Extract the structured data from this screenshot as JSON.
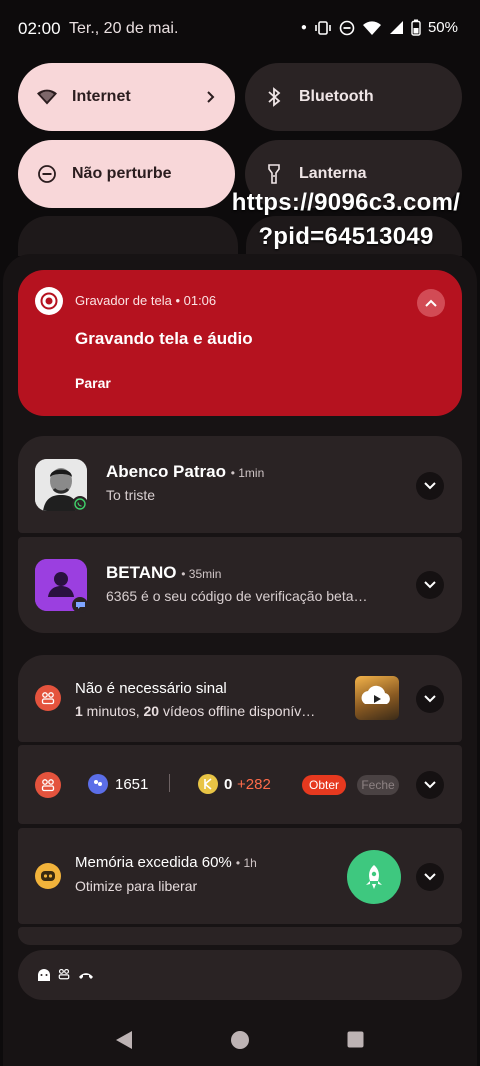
{
  "status_bar": {
    "time": "02:00",
    "date": "Ter., 20 de mai.",
    "battery": "50%"
  },
  "quick_tiles": [
    {
      "label": "Internet",
      "icon": "wifi-icon",
      "active": true
    },
    {
      "label": "Bluetooth",
      "icon": "bluetooth-icon",
      "active": false
    },
    {
      "label": "Não perturbe",
      "icon": "dnd-icon",
      "active": true
    },
    {
      "label": "Lanterna",
      "icon": "flashlight-icon",
      "active": false
    }
  ],
  "overlay_text": {
    "line1": "https://9096c3.com/",
    "line2": "?pid=64513049"
  },
  "recorder": {
    "app": "Gravador de tela • 01:06",
    "title": "Gravando tela e áudio",
    "action": "Parar",
    "accent": "#b5121f"
  },
  "notifications": {
    "whatsapp": {
      "title": "Abenco Patrao",
      "time": "• 1min",
      "body": "To triste"
    },
    "betano": {
      "title": "BETANO",
      "time": "• 35min",
      "body": "6365 é o seu código de verificação beta…"
    },
    "offline": {
      "title": "Não é necessário sinal",
      "body_num1": "1",
      "body_mid": " minutos, ",
      "body_num2": "20",
      "body_rest": " vídeos offline disponív…"
    },
    "coins": {
      "gems": "1651",
      "coins": "0",
      "bonus": "+282",
      "obter": "Obter",
      "feche": "Feche"
    },
    "memory": {
      "title": "Memória excedida 60%",
      "time": "• 1h",
      "body": "Otimize para liberar"
    }
  },
  "colors": {
    "tile_on": "#f8d7d9",
    "tile_off": "#2a2324",
    "card": "#2a2324",
    "rocket_green": "#3ec87f"
  }
}
